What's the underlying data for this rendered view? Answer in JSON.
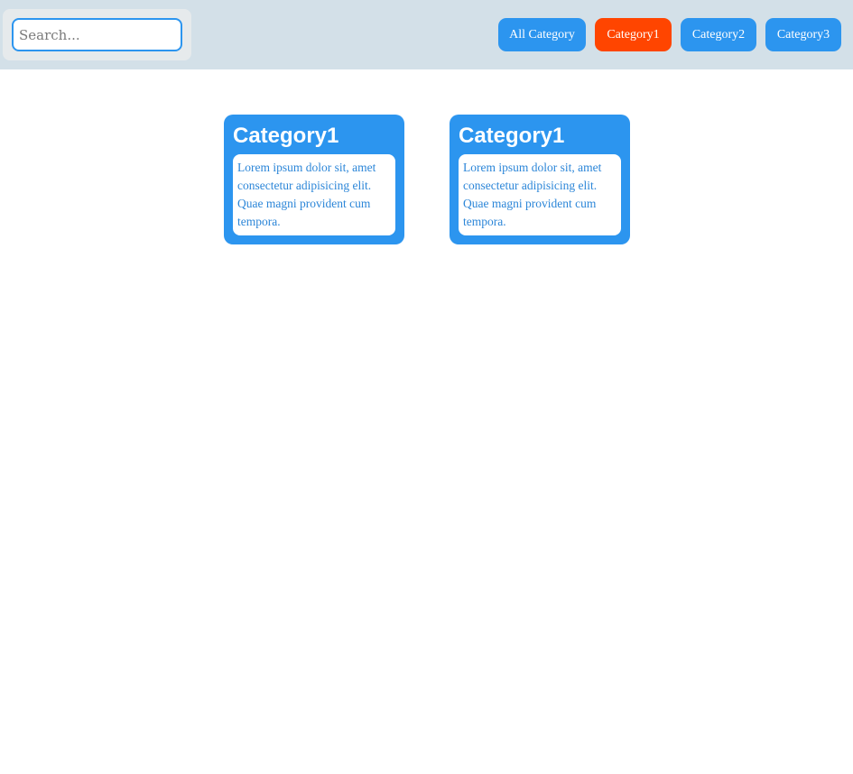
{
  "search": {
    "placeholder": "Search..."
  },
  "categories": [
    {
      "label": "All Category",
      "active": false
    },
    {
      "label": "Category1",
      "active": true
    },
    {
      "label": "Category2",
      "active": false
    },
    {
      "label": "Category3",
      "active": false
    }
  ],
  "cards": [
    {
      "title": "Category1",
      "text": "Lorem ipsum dolor sit, amet consectetur adipisicing elit. Quae magni provident cum tempora."
    },
    {
      "title": "Category1",
      "text": "Lorem ipsum dolor sit, amet consectetur adipisicing elit. Quae magni provident cum tempora."
    }
  ],
  "colors": {
    "topbar": "#d3e0e8",
    "button": "#2c95ef",
    "active_button": "#ff4500",
    "card": "#2c95ef",
    "card_text": "#2c86d8"
  }
}
